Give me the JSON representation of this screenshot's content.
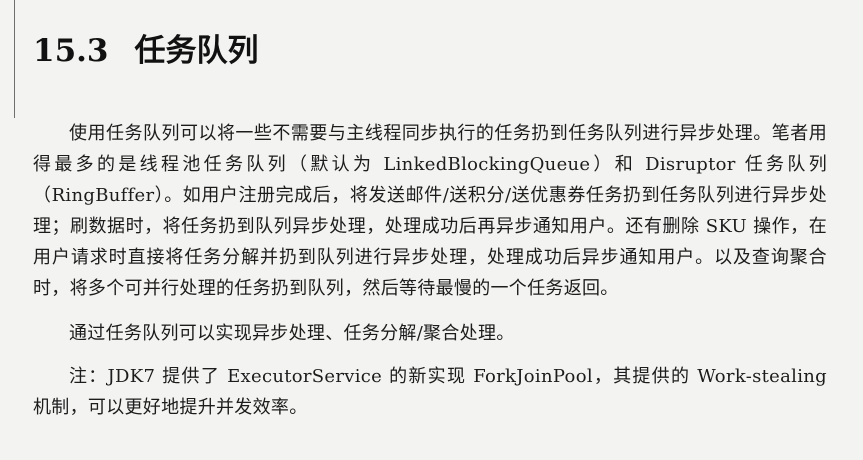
{
  "section": {
    "number": "15.3",
    "title": "任务队列"
  },
  "paragraphs": [
    "使用任务队列可以将一些不需要与主线程同步执行的任务扔到任务队列进行异步处理。笔者用得最多的是线程池任务队列（默认为 LinkedBlockingQueue）和 Disruptor 任务队列（RingBuffer）。如用户注册完成后，将发送邮件/送积分/送优惠券任务扔到任务队列进行异步处理；刷数据时，将任务扔到队列异步处理，处理成功后再异步通知用户。还有删除 SKU 操作，在用户请求时直接将任务分解并扔到队列进行异步处理，处理成功后异步通知用户。以及查询聚合时，将多个可并行处理的任务扔到队列，然后等待最慢的一个任务返回。",
    "通过任务队列可以实现异步处理、任务分解/聚合处理。",
    "注：JDK7 提供了 ExecutorService 的新实现 ForkJoinPool，其提供的 Work-stealing 机制，可以更好地提升并发效率。"
  ]
}
